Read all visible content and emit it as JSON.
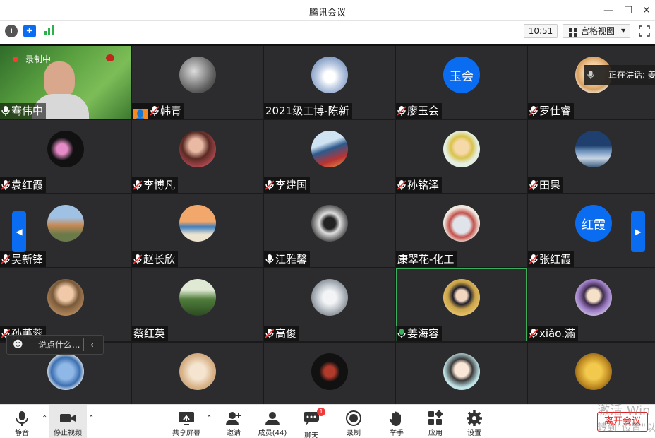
{
  "window": {
    "title": "腾讯会议"
  },
  "topbar": {
    "time": "10:51",
    "view_label": "宫格视图"
  },
  "recording": {
    "label": "录制中"
  },
  "speaking": {
    "label": "正在讲话: 姜"
  },
  "chat": {
    "placeholder": "说点什么..."
  },
  "participants": [
    {
      "name": "骞伟中"
    },
    {
      "name": "韩青"
    },
    {
      "name": "2021级工博-陈新"
    },
    {
      "name": "廖玉会",
      "avatar_text": "玉会"
    },
    {
      "name": "罗仕睿"
    },
    {
      "name": "袁红霞"
    },
    {
      "name": "李博凡"
    },
    {
      "name": "李建国"
    },
    {
      "name": "孙铭泽"
    },
    {
      "name": "田果"
    },
    {
      "name": "吴新锋"
    },
    {
      "name": "赵长欣"
    },
    {
      "name": "江雅馨"
    },
    {
      "name": "康翠花-化工"
    },
    {
      "name": "张红霞",
      "avatar_text": "红霞"
    },
    {
      "name": "孙芙蓉"
    },
    {
      "name": "蔡红英"
    },
    {
      "name": "高俊"
    },
    {
      "name": "姜海容"
    },
    {
      "name": "xiǎo.滿"
    }
  ],
  "toolbar": {
    "mute": "静音",
    "stop_video": "停止视频",
    "share": "共享屏幕",
    "invite": "邀请",
    "members": "成员(44)",
    "chat": "聊天",
    "chat_badge": "1",
    "record": "录制",
    "raise_hand": "举手",
    "apps": "应用",
    "settings": "设置",
    "leave": "离开会议"
  },
  "watermark": {
    "line1": "激活 Win",
    "line2": "转到\"设置\"以"
  },
  "colors": {
    "accent": "#0a6cf0",
    "leave": "#e02020",
    "tile": "#2c2c2e",
    "active_speaker": "#3cae5c"
  }
}
